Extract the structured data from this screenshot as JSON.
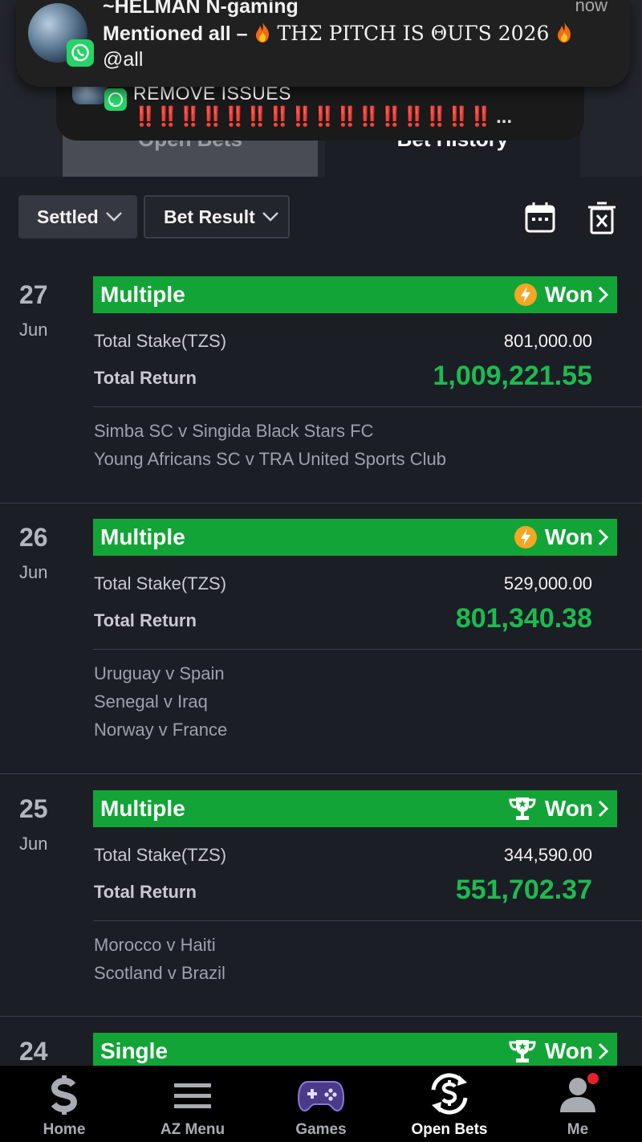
{
  "notifications": {
    "primary": {
      "sender": "~HELMAN N-gaming",
      "time": "now",
      "message_prefix": "Mentioned all – ",
      "message_body": " ΤΗΣ PITCH IS ΘUΓS 2026 ",
      "mention": "@all"
    },
    "secondary": {
      "title": "REMOVE ISSUES",
      "bangs": "‼️‼️‼️‼️‼️‼️‼️‼️‼️‼️‼️‼️‼️‼️‼️‼️",
      "ellipsis": "..."
    }
  },
  "tabs": {
    "open_bets": "Open Bets",
    "bet_history": "Bet History"
  },
  "filters": {
    "settled": "Settled",
    "bet_result": "Bet Result"
  },
  "bets": [
    {
      "day": "27",
      "month": "Jun",
      "type": "Multiple",
      "result": "Won",
      "icon": "lightning-icon",
      "stake_label": "Total Stake(TZS)",
      "stake": "801,000.00",
      "return_label": "Total Return",
      "return": "1,009,221.55",
      "matches": [
        "Simba SC v Singida Black Stars FC",
        "Young Africans SC v TRA United Sports Club"
      ]
    },
    {
      "day": "26",
      "month": "Jun",
      "type": "Multiple",
      "result": "Won",
      "icon": "lightning-icon",
      "stake_label": "Total Stake(TZS)",
      "stake": "529,000.00",
      "return_label": "Total Return",
      "return": "801,340.38",
      "matches": [
        "Uruguay v Spain",
        "Senegal v Iraq",
        "Norway v France"
      ]
    },
    {
      "day": "25",
      "month": "Jun",
      "type": "Multiple",
      "result": "Won",
      "icon": "trophy-icon",
      "stake_label": "Total Stake(TZS)",
      "stake": "344,590.00",
      "return_label": "Total Return",
      "return": "551,702.37",
      "matches": [
        "Morocco v Haiti",
        "Scotland v Brazil"
      ]
    },
    {
      "day": "24",
      "type": "Single",
      "result": "Won",
      "icon": "trophy-icon"
    }
  ],
  "nav": {
    "home": "Home",
    "az_menu": "AZ Menu",
    "games": "Games",
    "open_bets": "Open Bets",
    "me": "Me"
  },
  "colors": {
    "background": "#1c1e26",
    "won_header": "#12a437",
    "return_green": "#1dbb4e",
    "notification_dot": "#e8202a"
  }
}
